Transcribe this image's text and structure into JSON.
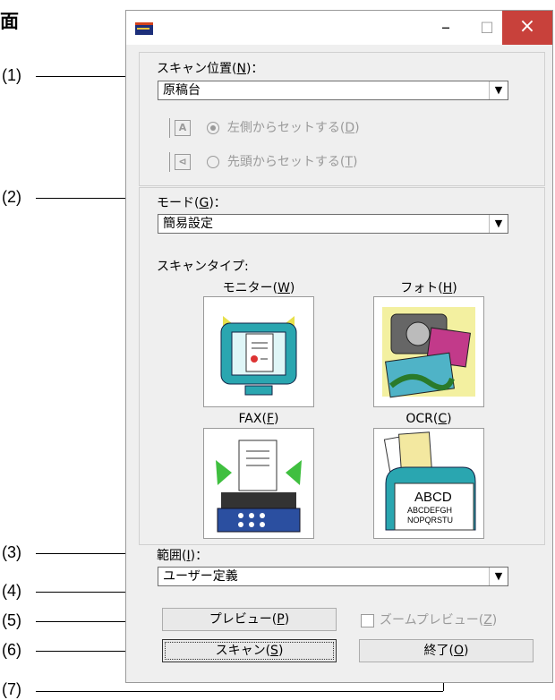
{
  "heading": "面",
  "callouts": [
    "(1)",
    "(2)",
    "(3)",
    "(4)",
    "(5)",
    "(6)",
    "(7)"
  ],
  "window": {
    "buttons": {
      "minimize": "–",
      "maximize": "□",
      "close": "×"
    }
  },
  "scan_position": {
    "label": "スキャン位置(",
    "mnemonic": "N",
    "label_end": ")：",
    "value": "原稿台",
    "options": [
      {
        "label": "左側からセットする(",
        "mnemonic": "D",
        "end": ")",
        "selected": true,
        "icon_letter": "A"
      },
      {
        "label": "先頭からセットする(",
        "mnemonic": "T",
        "end": ")",
        "selected": false,
        "icon_letter": "⊲"
      }
    ]
  },
  "mode": {
    "label": "モード(",
    "mnemonic": "G",
    "label_end": ")：",
    "value": "簡易設定"
  },
  "scan_type": {
    "label": "スキャンタイプ:",
    "items": [
      {
        "label": "モニター(",
        "mnemonic": "W",
        "end": ")"
      },
      {
        "label": "フォト(",
        "mnemonic": "H",
        "end": ")"
      },
      {
        "label": "FAX(",
        "mnemonic": "F",
        "end": ")"
      },
      {
        "label": "OCR(",
        "mnemonic": "C",
        "end": ")"
      }
    ],
    "ocr_text": [
      "ABCD",
      "ABCDEFGH",
      "NOPQRSTU"
    ]
  },
  "range": {
    "label": "範囲(",
    "mnemonic": "I",
    "label_end": ")：",
    "value": "ユーザー定義"
  },
  "zoom_preview": {
    "label": "ズームプレビュー(",
    "mnemonic": "Z",
    "end": ")"
  },
  "buttons": {
    "preview": {
      "label": "プレビュー(",
      "mnemonic": "P",
      "end": ")"
    },
    "scan": {
      "label": "スキャン(",
      "mnemonic": "S",
      "end": ")"
    },
    "exit": {
      "label": "終了(",
      "mnemonic": "O",
      "end": ")"
    }
  },
  "colors": {
    "close_button": "#c8413b",
    "window_bg": "#efefef"
  }
}
